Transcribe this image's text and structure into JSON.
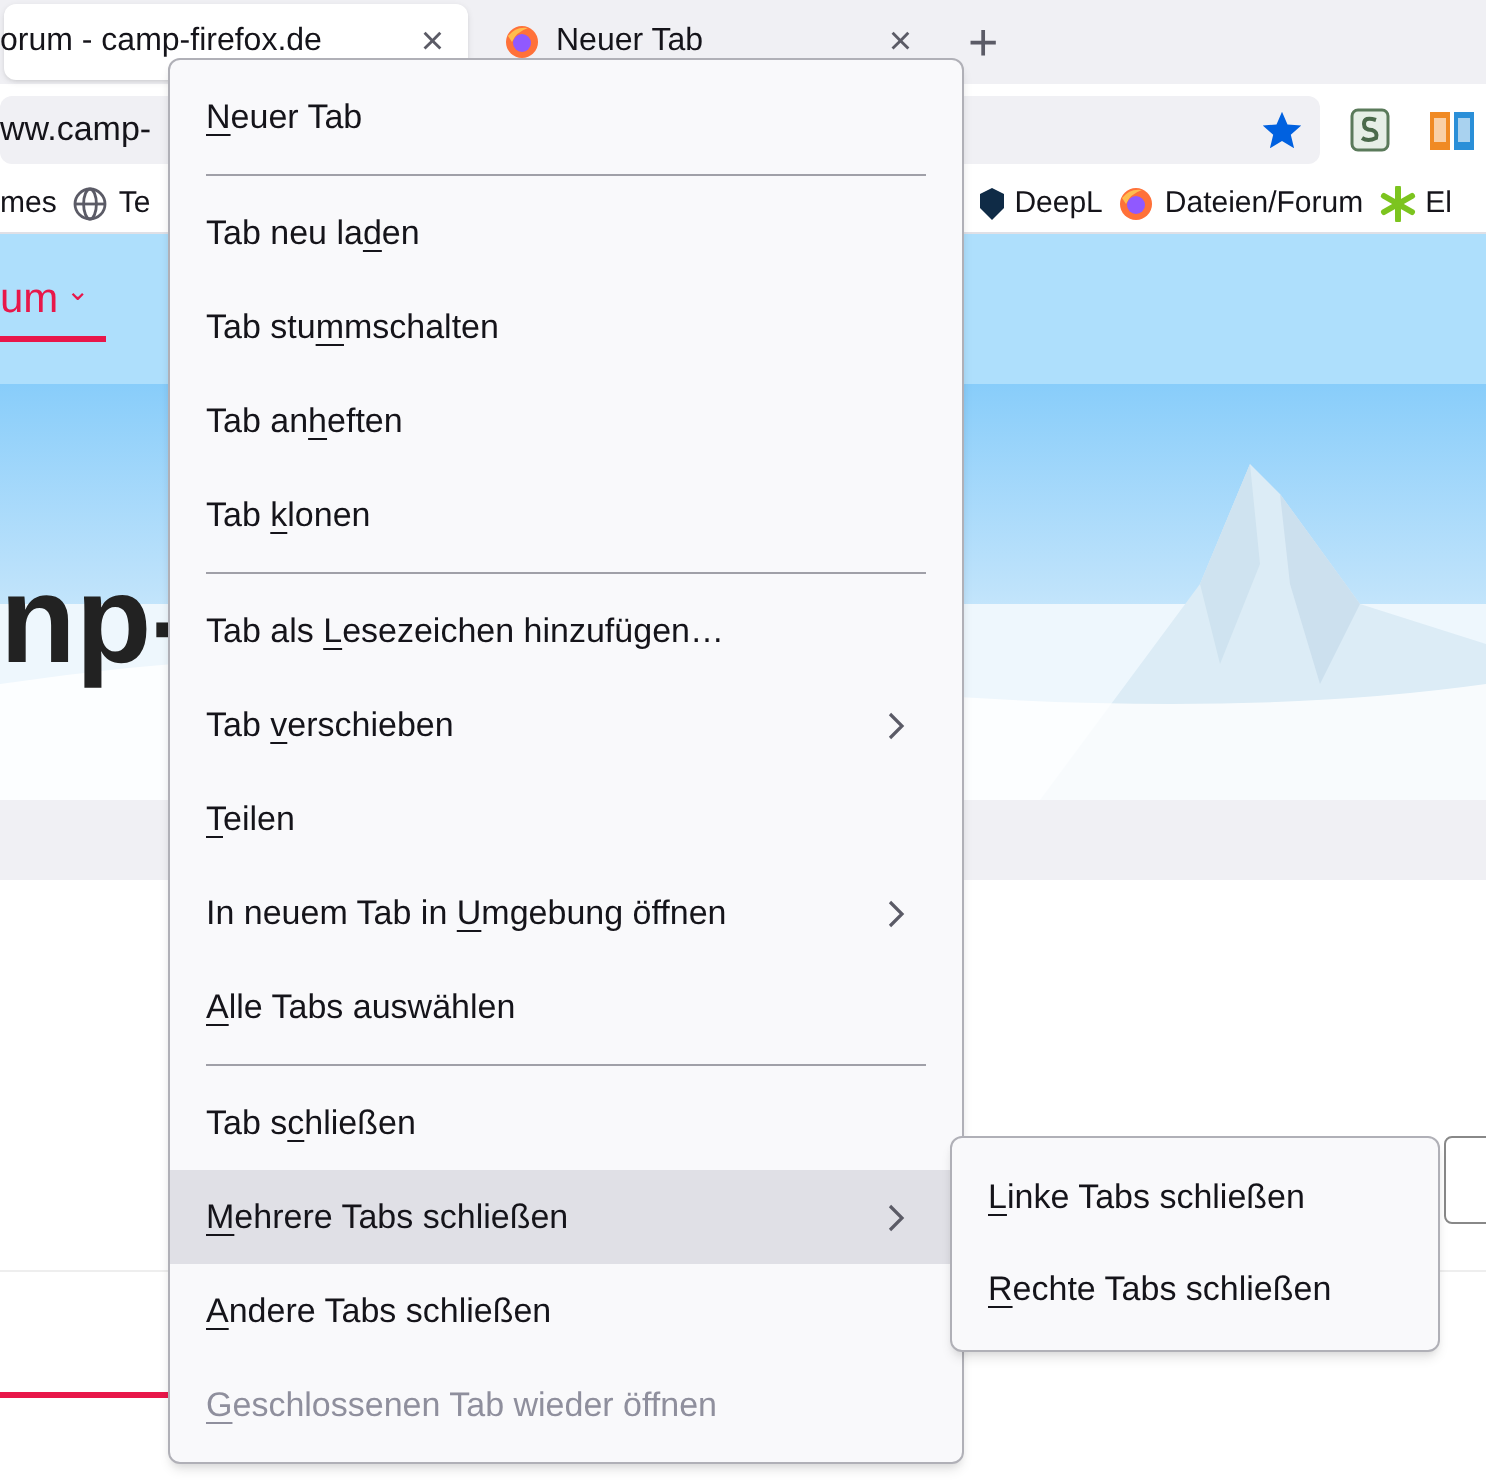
{
  "tabs": [
    {
      "title": "orum - camp-firefox.de",
      "close": "×",
      "selected": true
    },
    {
      "title": "Neuer Tab",
      "close": "×",
      "selected": false
    }
  ],
  "new_tab": "+",
  "address_bar": {
    "value": "ww.camp-"
  },
  "bookmarks": [
    {
      "kind": "plain",
      "label": "mes"
    },
    {
      "kind": "globe",
      "label": "Te"
    },
    {
      "kind": "deepl",
      "label": "DeepL"
    },
    {
      "kind": "firefox",
      "label": "Dateien/Forum"
    },
    {
      "kind": "star",
      "label": "El"
    }
  ],
  "site": {
    "nav_item": "um",
    "nav_caret": "⌄",
    "hero_text": "np-"
  },
  "context_menu": {
    "items": [
      {
        "kind": "item",
        "key": "N",
        "post": "euer Tab",
        "submenu": false,
        "disabled": false,
        "selected": false
      },
      {
        "kind": "separator"
      },
      {
        "kind": "item",
        "pre": "Tab neu la",
        "key": "d",
        "post": "en",
        "submenu": false,
        "disabled": false,
        "selected": false
      },
      {
        "kind": "item",
        "pre": "Tab stu",
        "key": "m",
        "post": "mschalten",
        "submenu": false,
        "disabled": false,
        "selected": false
      },
      {
        "kind": "item",
        "pre": "Tab an",
        "key": "h",
        "post": "eften",
        "submenu": false,
        "disabled": false,
        "selected": false
      },
      {
        "kind": "item",
        "pre": "Tab ",
        "key": "k",
        "post": "lonen",
        "submenu": false,
        "disabled": false,
        "selected": false
      },
      {
        "kind": "separator"
      },
      {
        "kind": "item",
        "pre": "Tab als ",
        "key": "L",
        "post": "esezeichen hinzufügen…",
        "submenu": false,
        "disabled": false,
        "selected": false
      },
      {
        "kind": "item",
        "pre": "Tab ",
        "key": "v",
        "post": "erschieben",
        "submenu": true,
        "disabled": false,
        "selected": false
      },
      {
        "kind": "item",
        "key": "T",
        "post": "eilen",
        "submenu": false,
        "disabled": false,
        "selected": false
      },
      {
        "kind": "item",
        "pre": "In neuem Tab in ",
        "key": "U",
        "post": "mgebung öffnen",
        "submenu": true,
        "disabled": false,
        "selected": false
      },
      {
        "kind": "item",
        "key": "A",
        "post": "lle Tabs auswählen",
        "submenu": false,
        "disabled": false,
        "selected": false
      },
      {
        "kind": "separator"
      },
      {
        "kind": "item",
        "pre": "Tab s",
        "key": "c",
        "post": "hließen",
        "submenu": false,
        "disabled": false,
        "selected": false
      },
      {
        "kind": "item",
        "key": "M",
        "post": "ehrere Tabs schließen",
        "submenu": true,
        "disabled": false,
        "selected": true
      },
      {
        "kind": "item",
        "key": "A",
        "post": "ndere Tabs schließen",
        "submenu": false,
        "disabled": false,
        "selected": false
      },
      {
        "kind": "item",
        "key": "G",
        "post": "eschlossenen Tab wieder öffnen",
        "submenu": false,
        "disabled": true,
        "selected": false
      }
    ]
  },
  "submenu": {
    "items": [
      {
        "key": "L",
        "post": "inke Tabs schließen",
        "selected": false
      },
      {
        "key": "R",
        "post": "echte Tabs schließen",
        "selected": false
      }
    ]
  }
}
